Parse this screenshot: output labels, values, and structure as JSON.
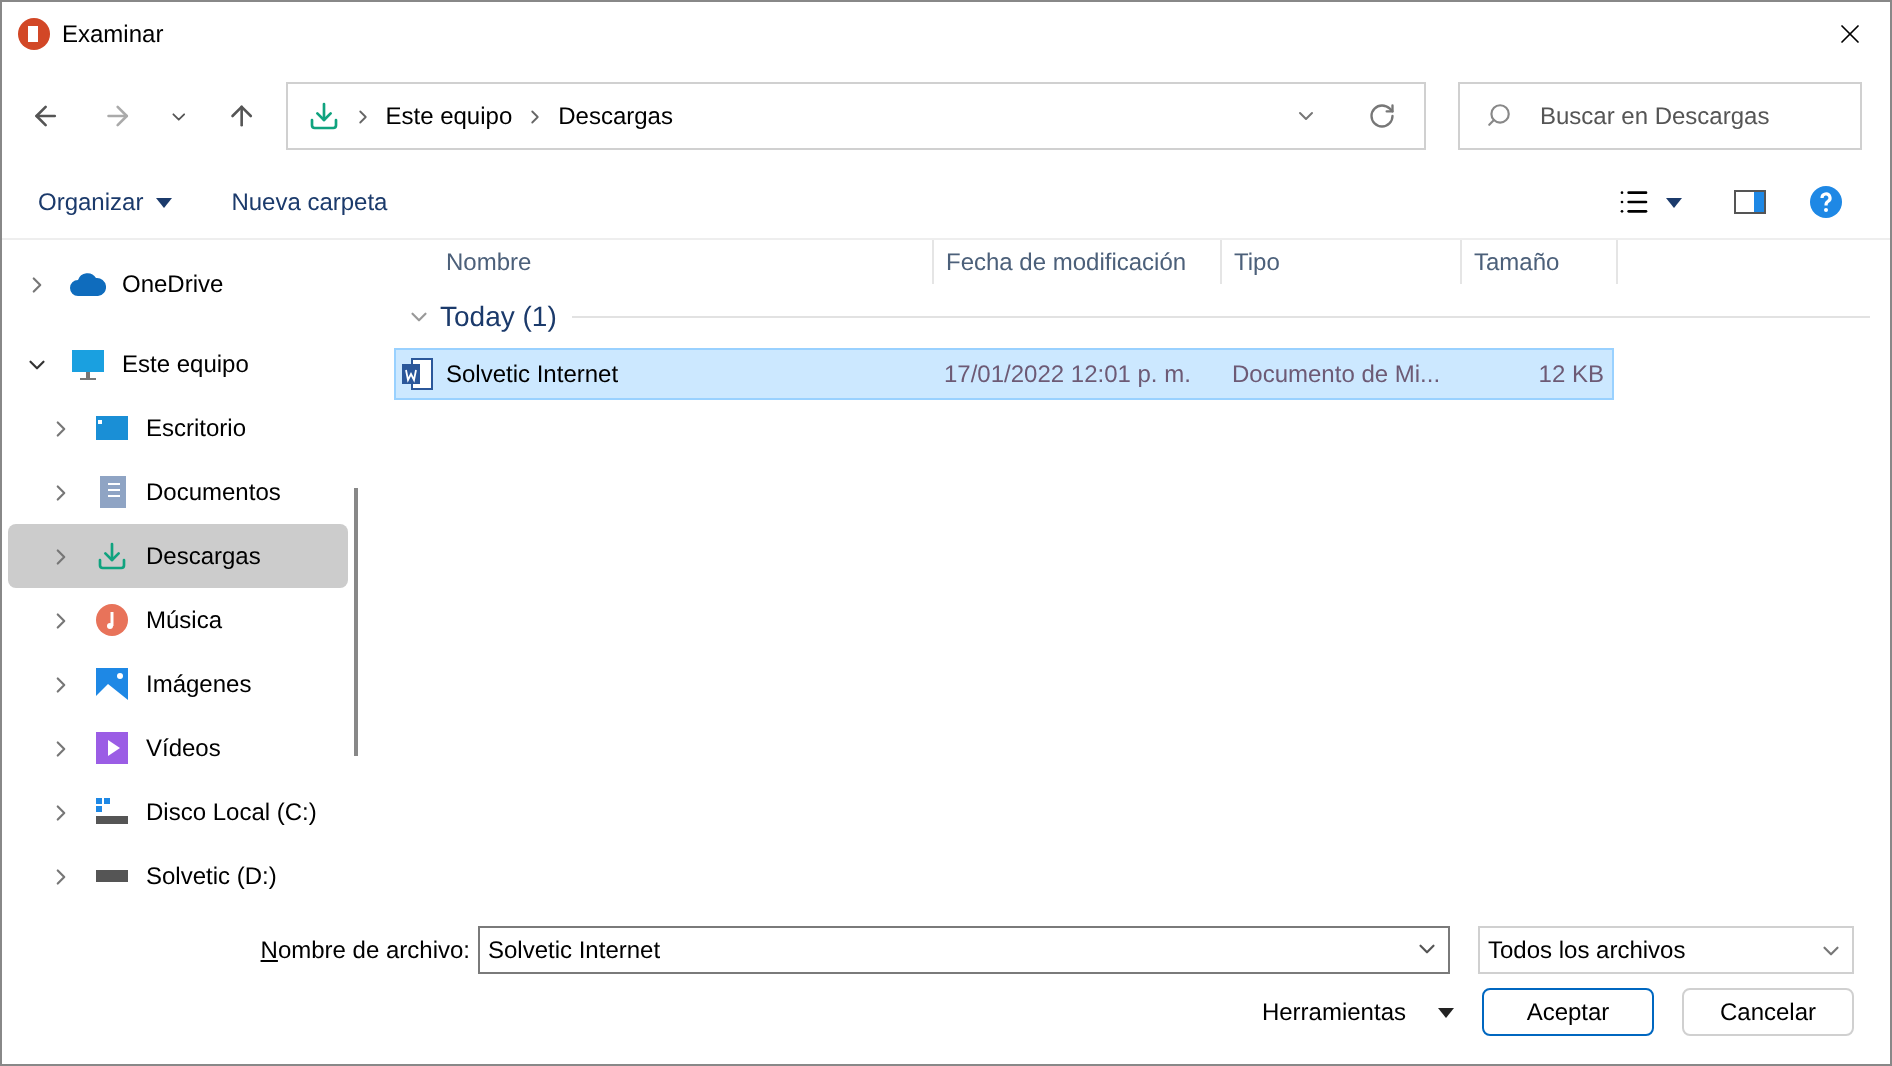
{
  "window": {
    "title": "Examinar"
  },
  "address": {
    "path": [
      "Este equipo",
      "Descargas"
    ]
  },
  "search": {
    "placeholder": "Buscar en Descargas"
  },
  "toolbar": {
    "organize": "Organizar",
    "new_folder": "Nueva carpeta"
  },
  "sidebar": {
    "items": [
      {
        "label": "OneDrive",
        "kind": "cloud",
        "expanded": false,
        "selected": false
      },
      {
        "label": "Este equipo",
        "kind": "pc",
        "expanded": true,
        "selected": false,
        "children": [
          {
            "label": "Escritorio",
            "kind": "desktop",
            "expanded": false,
            "selected": false
          },
          {
            "label": "Documentos",
            "kind": "documents",
            "expanded": false,
            "selected": false
          },
          {
            "label": "Descargas",
            "kind": "downloads",
            "expanded": false,
            "selected": true
          },
          {
            "label": "Música",
            "kind": "music",
            "expanded": false,
            "selected": false
          },
          {
            "label": "Imágenes",
            "kind": "pictures",
            "expanded": false,
            "selected": false
          },
          {
            "label": "Vídeos",
            "kind": "videos",
            "expanded": false,
            "selected": false
          },
          {
            "label": "Disco Local (C:)",
            "kind": "system_drive",
            "expanded": false,
            "selected": false
          },
          {
            "label": "Solvetic (D:)",
            "kind": "drive",
            "expanded": false,
            "selected": false
          }
        ]
      }
    ]
  },
  "table": {
    "columns": [
      "Nombre",
      "Fecha de modificación",
      "Tipo",
      "Tamaño"
    ],
    "groups": [
      {
        "label": "Today (1)",
        "expanded": true,
        "rows": [
          {
            "name": "Solvetic Internet",
            "date": "17/01/2022 12:01 p. m.",
            "type": "Documento de Mi...",
            "size": "12 KB",
            "selected": true
          }
        ]
      }
    ]
  },
  "footer": {
    "filename_label": "Nombre de archivo:",
    "filename": "Solvetic Internet",
    "filter": "Todos los archivos",
    "tools": "Herramientas",
    "buttons": [
      "Aceptar",
      "Cancelar"
    ]
  }
}
